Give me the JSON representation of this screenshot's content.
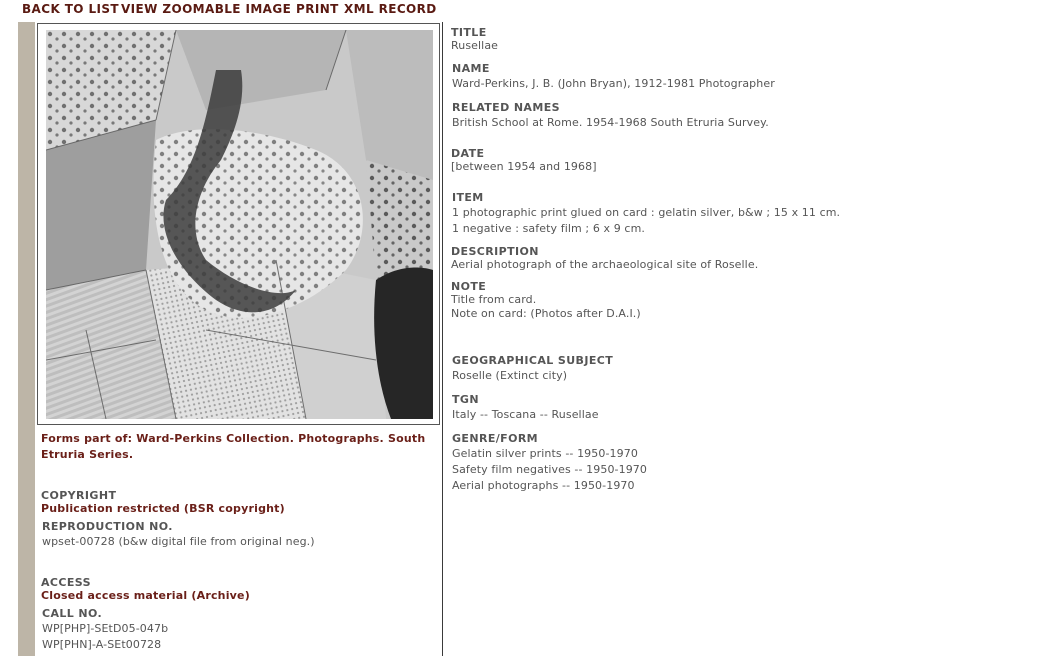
{
  "nav": {
    "back_to_list": "BACK TO LIST",
    "view_zoomable": "VIEW ZOOMABLE IMAGE",
    "print": "PRINT",
    "xml_record": "XML RECORD"
  },
  "colors": {
    "accent_text": "#6a1f18",
    "sidebar": "#bdb5a7",
    "label_text": "#555555"
  },
  "left": {
    "forms_part_of_line1": "Forms part of: Ward-Perkins Collection. Photographs. South",
    "forms_part_of_line2": "Etruria Series.",
    "copyright_label": "COPYRIGHT",
    "copyright_value": "Publication restricted (BSR copyright)",
    "reproduction_label": "REPRODUCTION NO.",
    "reproduction_value": "wpset-00728 (b&w digital file from original neg.)",
    "access_label": "ACCESS",
    "access_value": "Closed access material (Archive)",
    "call_no_label": "CALL NO.",
    "call_no_values": [
      "WP[PHP]-SEtD05-047b",
      "WP[PHN]-A-SEt00728"
    ]
  },
  "record": {
    "title_label": "TITLE",
    "title_value": "Rusellae",
    "name_label": "NAME",
    "name_value": "Ward-Perkins, J. B. (John Bryan), 1912-1981 Photographer",
    "related_label": "RELATED NAMES",
    "related_value": "British School at Rome. 1954-1968 South Etruria Survey.",
    "date_label": "DATE",
    "date_value": "[between 1954 and 1968]",
    "item_label": "ITEM",
    "item_values": [
      "1 photographic print glued on card : gelatin silver, b&w ; 15 x 11 cm.",
      "1 negative : safety film ; 6 x 9 cm."
    ],
    "description_label": "DESCRIPTION",
    "description_value": "Aerial photograph of the archaeological site of Roselle.",
    "note_label": "NOTE",
    "note_values": [
      "Title from card.",
      "Note on card: (Photos after D.A.I.)"
    ],
    "geo_label": "GEOGRAPHICAL SUBJECT",
    "geo_value": "Roselle (Extinct city)",
    "tgn_label": "TGN",
    "tgn_value": "Italy -- Toscana -- Rusellae",
    "genre_label": "GENRE/FORM",
    "genre_values": [
      "Gelatin silver prints -- 1950-1970",
      "Safety film negatives -- 1950-1970",
      "Aerial photographs -- 1950-1970"
    ]
  }
}
